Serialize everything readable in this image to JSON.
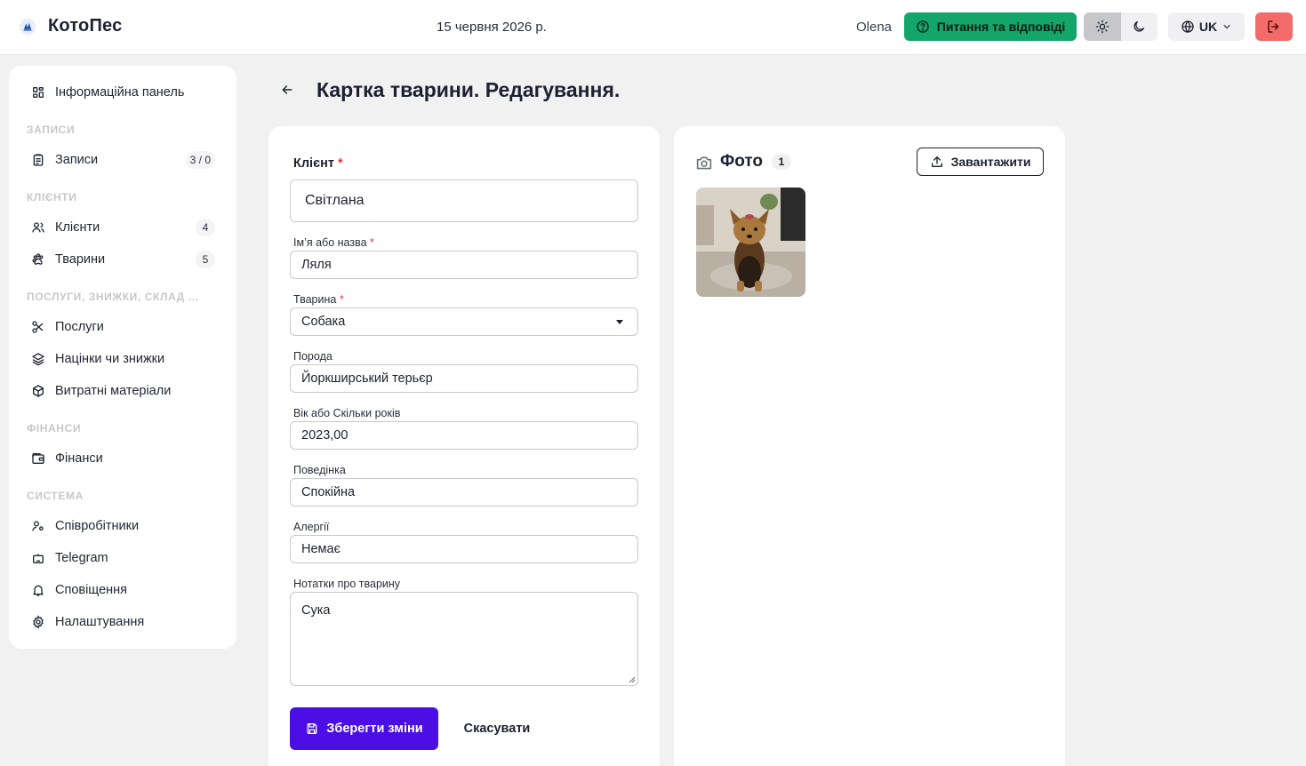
{
  "header": {
    "app_name": "КотоПес",
    "date": "15 червня 2026 р.",
    "user": "Olena",
    "faq_label": "Питання та відповіді",
    "language": "UK",
    "icons": {
      "logo": "cat-dog-logo-icon",
      "faq": "question-circle-icon",
      "light": "sun-icon",
      "dark": "moon-icon",
      "language": "globe-icon",
      "logout": "logout-icon"
    },
    "colors": {
      "faq": "#13a56a",
      "logout": "#f26a6a"
    }
  },
  "sidebar": {
    "dashboard": "Інформаційна панель",
    "sections": [
      {
        "label": "Записи",
        "items": [
          {
            "label": "Записи",
            "badge": "3 / 0",
            "icon": "clipboard-icon"
          }
        ]
      },
      {
        "label": "Клієнти",
        "items": [
          {
            "label": "Клієнти",
            "badge": "4",
            "icon": "users-icon"
          },
          {
            "label": "Тварини",
            "badge": "5",
            "icon": "paw-icon"
          }
        ]
      },
      {
        "label": "Послуги, знижки, склад ...",
        "items": [
          {
            "label": "Послуги",
            "icon": "scissors-icon"
          },
          {
            "label": "Націнки чи знижки",
            "icon": "layers-icon"
          },
          {
            "label": "Витратні матеріали",
            "icon": "box-icon"
          }
        ]
      },
      {
        "label": "Фінанси",
        "items": [
          {
            "label": "Фінанси",
            "icon": "wallet-icon"
          }
        ]
      },
      {
        "label": "Система",
        "items": [
          {
            "label": "Співробітники",
            "icon": "user-key-icon"
          },
          {
            "label": "Telegram",
            "icon": "bot-icon"
          },
          {
            "label": "Сповіщення",
            "icon": "bell-icon"
          },
          {
            "label": "Налаштування",
            "icon": "gear-icon"
          }
        ]
      }
    ]
  },
  "page": {
    "title": "Картка тварини. Редагування."
  },
  "form": {
    "client": {
      "label": "Клієнт",
      "value": "Світлана"
    },
    "name": {
      "label": "Ім’я або назва",
      "value": "Ляля"
    },
    "animal": {
      "label": "Тварина",
      "value": "Собака"
    },
    "breed": {
      "label": "Порода",
      "value": "Йоркширський терьєр"
    },
    "age": {
      "label": "Вік або Скільки років",
      "value": "2023,00"
    },
    "behavior": {
      "label": "Поведінка",
      "value": "Спокійна"
    },
    "allergies": {
      "label": "Алергії",
      "value": "Немає"
    },
    "notes": {
      "label": "Нотатки про тварину",
      "value": "Сука"
    },
    "required_mark": "*",
    "save_label": "Зберегти зміни",
    "cancel_label": "Скасувати",
    "save_color": "#4b0fe6"
  },
  "photos": {
    "title": "Фото",
    "count": "1",
    "upload_label": "Завантажити"
  }
}
